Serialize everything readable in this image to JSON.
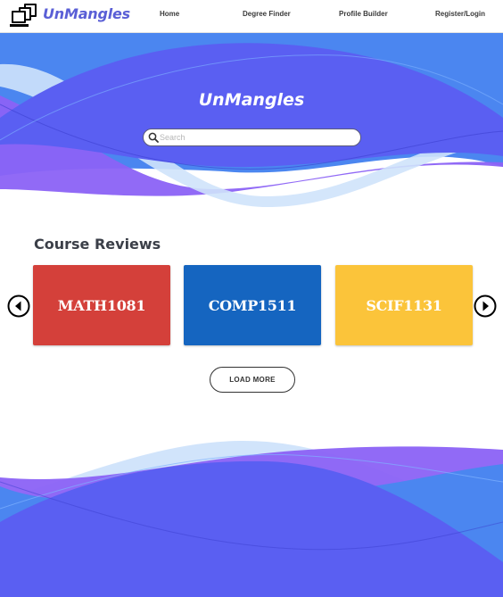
{
  "brand": {
    "name": "UnMangles",
    "icon": "stacked-screens-logo-icon"
  },
  "nav": {
    "links": [
      {
        "label": "Home"
      },
      {
        "label": "Degree Finder"
      },
      {
        "label": "Profile Builder"
      },
      {
        "label": "Register/Login"
      }
    ]
  },
  "hero": {
    "title": "UnMangles",
    "search": {
      "placeholder": "Search",
      "value": "",
      "icon": "search-icon"
    }
  },
  "reviews": {
    "title": "Course Reviews",
    "prev_icon": "chevron-left-circle-icon",
    "next_icon": "chevron-right-circle-icon",
    "cards": [
      {
        "code": "MATH1081",
        "color": "#d4403a"
      },
      {
        "code": "COMP1511",
        "color": "#1565c0"
      },
      {
        "code": "SCIF1131",
        "color": "#fbc43a"
      }
    ],
    "load_more": "LOAD MORE"
  },
  "colors": {
    "hero_blue": "#4b86f0",
    "wave_violet": "#8b62f5",
    "wave_indigo": "#5a5ff2",
    "wave_light": "#cfe3fb",
    "brand_text": "#5a5fd6"
  }
}
